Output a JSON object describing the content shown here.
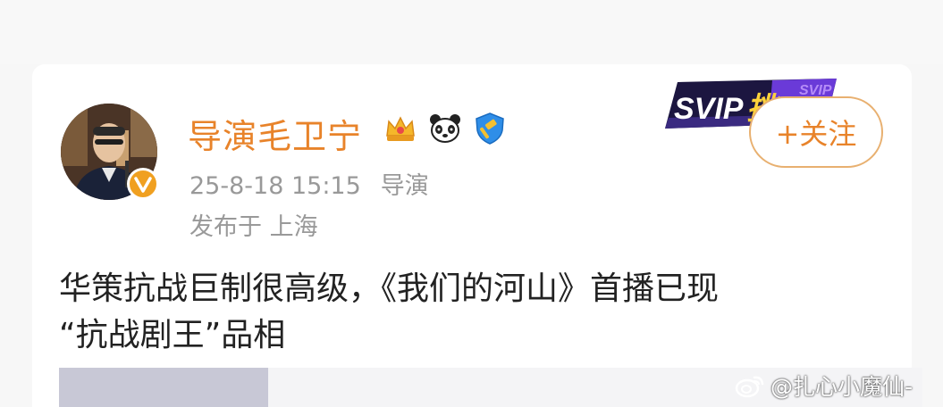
{
  "post": {
    "author": "导演毛卫宁",
    "time": "25-8-18 15:15",
    "role": "导演",
    "location": "发布于 上海",
    "follow_label": "+关注",
    "text_line1": "华策抗战巨制很高级，《我们的河山》首播已现",
    "text_line2": "“抗战剧王”品相"
  },
  "badges": [
    {
      "icon": "crown-icon",
      "color": "#f5b72a"
    },
    {
      "icon": "panda-icon",
      "color": "#222222"
    },
    {
      "icon": "shield-hammer-icon",
      "color": "#2f8ee8"
    }
  ],
  "banner": {
    "text": "SVIP",
    "subtext": "挑"
  },
  "watermark": "@扎心小魔仙-",
  "colors": {
    "accent": "#e8832a",
    "follow_border": "#e8b070",
    "meta": "#999999",
    "verified": "#f0a020"
  }
}
